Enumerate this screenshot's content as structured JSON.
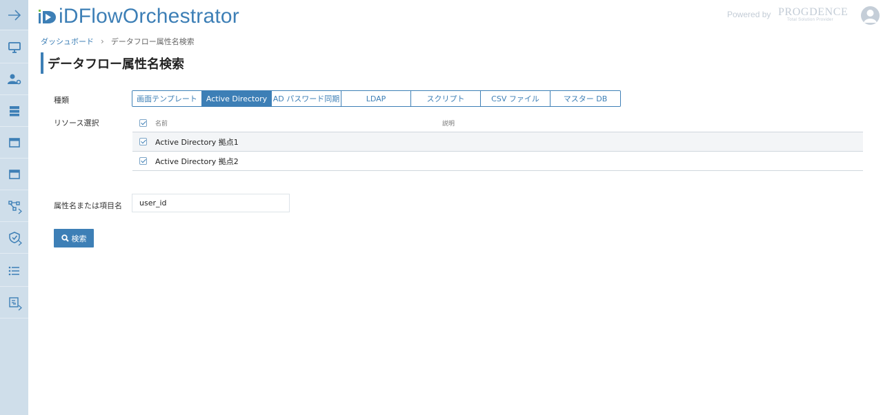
{
  "app": {
    "title": "iDFlowOrchestrator",
    "powered_by": "Powered by",
    "brand": "PROGDENCE",
    "brand_sub": "Total Solution Provider"
  },
  "sidebar": {
    "items": [
      {
        "icon": "arrow-right-icon"
      },
      {
        "icon": "monitor-icon"
      },
      {
        "icon": "user-settings-icon"
      },
      {
        "icon": "server-icon"
      },
      {
        "icon": "window-icon"
      },
      {
        "icon": "window-icon"
      },
      {
        "icon": "flow-icon"
      },
      {
        "icon": "shield-check-icon"
      },
      {
        "icon": "list-icon"
      },
      {
        "icon": "report-icon"
      }
    ]
  },
  "breadcrumb": {
    "home": "ダッシュボード",
    "current": "データフロー属性名検索"
  },
  "page": {
    "title": "データフロー属性名検索"
  },
  "form": {
    "type_label": "種類",
    "resource_label": "リソース選択",
    "attr_label": "属性名または項目名",
    "tabs": [
      {
        "label": "画面テンプレート",
        "active": false
      },
      {
        "label": "Active Directory",
        "active": true
      },
      {
        "label": "AD パスワード同期",
        "active": false
      },
      {
        "label": "LDAP",
        "active": false
      },
      {
        "label": "スクリプト",
        "active": false
      },
      {
        "label": "CSV ファイル",
        "active": false
      },
      {
        "label": "マスター DB",
        "active": false
      }
    ],
    "resources": {
      "header_name": "名前",
      "header_desc": "説明",
      "rows": [
        {
          "name": "Active Directory 拠点1",
          "desc": "",
          "checked": true
        },
        {
          "name": "Active Directory 拠点2",
          "desc": "",
          "checked": true
        }
      ]
    },
    "attr_value": "user_id",
    "search_label": "検索"
  },
  "colors": {
    "accent": "#3d7fb6",
    "sidebar_bg": "#cfdeea"
  }
}
